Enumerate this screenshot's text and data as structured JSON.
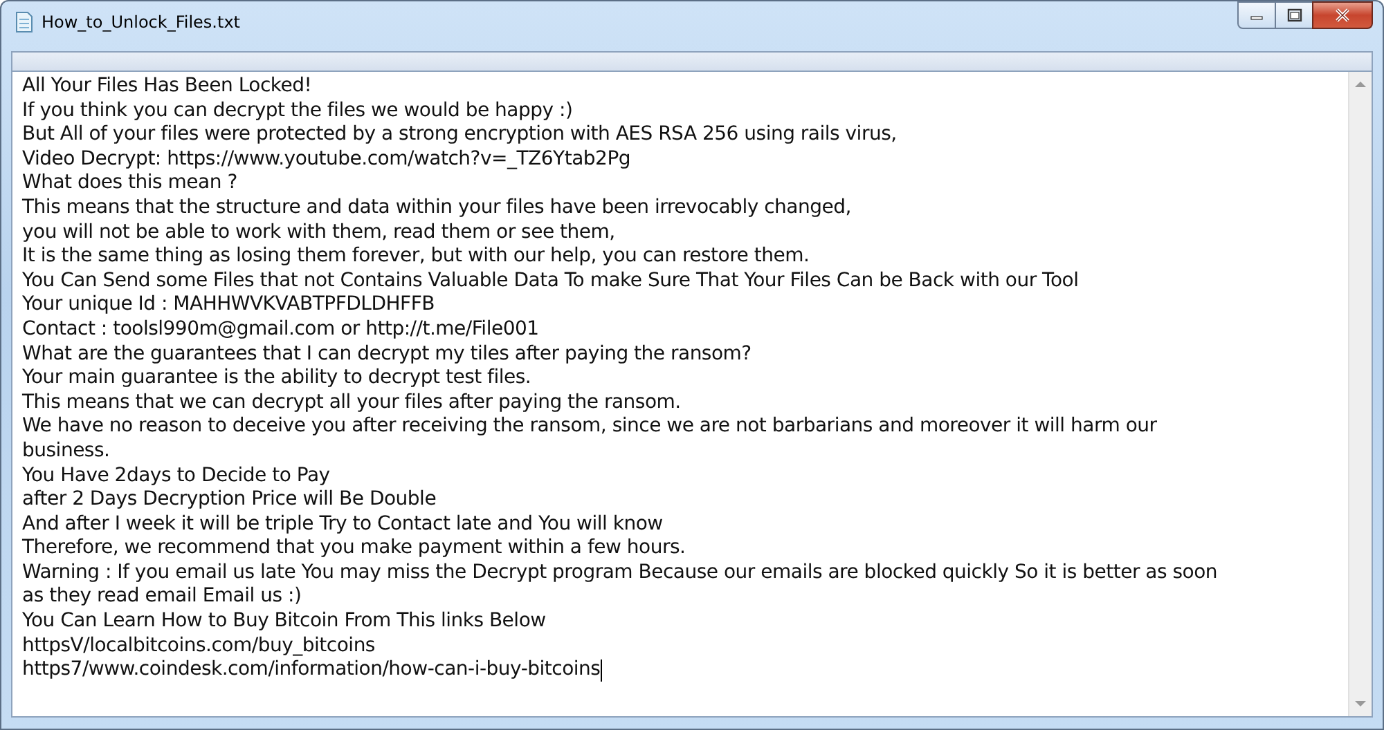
{
  "window": {
    "title": "How_to_Unlock_Files.txt"
  },
  "document": {
    "lines": [
      "All Your Files Has Been Locked!",
      "If you think you can decrypt the files we would be happy :)",
      "But All of your files were protected by a strong encryption with AES RSA 256 using rails virus,",
      "Video Decrypt: https://www.youtube.com/watch?v=_TZ6Ytab2Pg",
      "What does this mean ?",
      "This means that the structure and data within your files have been irrevocably changed,",
      "you will not be able to work with them, read them or see them,",
      "It is the same thing as losing them forever, but with our help, you can restore them.",
      "You Can Send some Files that not Contains Valuable Data To make Sure That Your Files Can be Back with our Tool",
      "Your unique Id : MAHHWVKVABTPFDLDHFFB",
      "Contact : toolsl990m@gmail.com or http://t.me/File001",
      "What are the guarantees that I can decrypt my tiles after paying the ransom?",
      "Your main guarantee is the ability to decrypt test files.",
      "This means that we can decrypt all your files after paying the ransom.",
      "We have no reason to deceive you after receiving the ransom, since we are not barbarians and moreover it will harm our",
      "business.",
      "You Have 2days to Decide to Pay",
      "after 2 Days Decryption Price will Be Double",
      "And after I week it will be triple Try to Contact late and You will know",
      "Therefore, we recommend that you make payment within a few hours.",
      "Warning : If you email us late You may miss the Decrypt program Because our emails are blocked quickly So it is better as soon",
      "as they read email Email us :)",
      "You Can Learn How to Buy Bitcoin From This links Below",
      "httpsV/localbitcoins.com/buy_bitcoins",
      "https7/www.coindesk.com/information/how-can-i-buy-bitcoins"
    ]
  }
}
